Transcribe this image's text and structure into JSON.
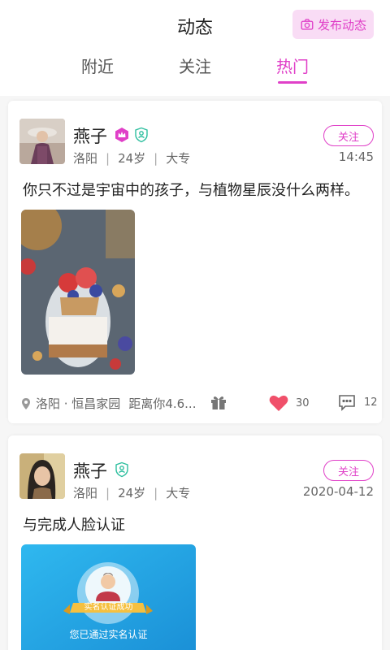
{
  "header": {
    "title": "动态",
    "publish_label": "发布动态",
    "tabs": [
      {
        "label": "附近",
        "active": false
      },
      {
        "label": "关注",
        "active": false
      },
      {
        "label": "热门",
        "active": true
      }
    ],
    "accent_color": "#e040c8"
  },
  "posts": [
    {
      "name": "燕子",
      "city": "洛阳",
      "age": "24岁",
      "education": "大专",
      "follow_label": "关注",
      "time": "14:45",
      "content": "你只不过是宇宙中的孩子，与植物星辰没什么两样。",
      "location": "洛阳 · 恒昌家园",
      "distance": "距离你4.6...",
      "likes": "30",
      "comments": "12",
      "badges": [
        "crown-icon",
        "verified-shield-icon"
      ]
    },
    {
      "name": "燕子",
      "city": "洛阳",
      "age": "24岁",
      "education": "大专",
      "follow_label": "关注",
      "time": "2020-04-12",
      "content": "与完成人脸认证",
      "badges": [
        "verified-shield-icon"
      ],
      "cert_card": {
        "ribbon": "实名认证成功",
        "text": "您已通过实名认证"
      }
    }
  ]
}
